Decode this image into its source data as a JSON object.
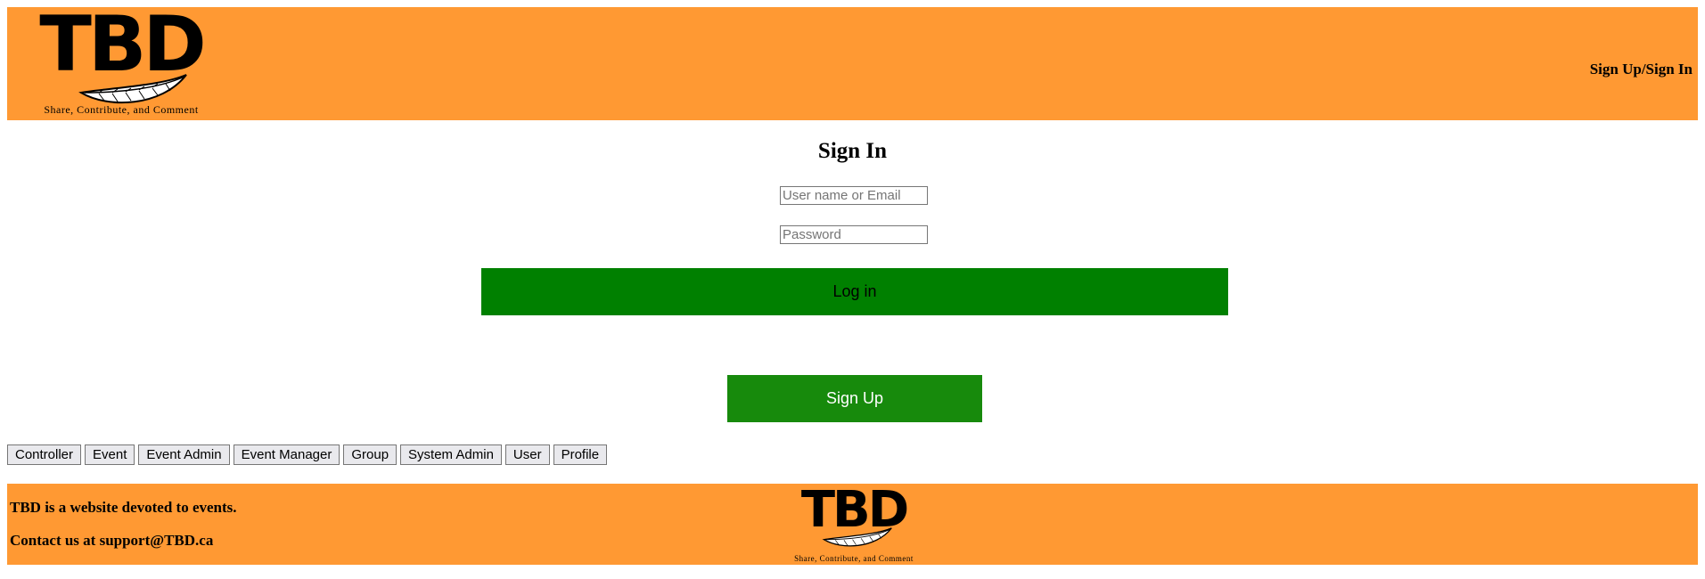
{
  "header": {
    "logo_text": "TBD",
    "tagline": "Share, Contribute, and Comment",
    "nav_link": "Sign Up/Sign In"
  },
  "signin": {
    "title": "Sign In",
    "username_placeholder": "User name or Email",
    "password_placeholder": "Password",
    "login_label": "Log in",
    "signup_label": "Sign Up"
  },
  "tabs": [
    "Controller",
    "Event",
    "Event Admin",
    "Event Manager",
    "Group",
    "System Admin",
    "User",
    "Profile"
  ],
  "footer": {
    "about": "TBD is a website devoted to events.",
    "contact": "Contact us at support@TBD.ca",
    "logo_text": "TBD",
    "tagline": "Share, Contribute, and Comment"
  },
  "colors": {
    "banner": "#ff9933",
    "login_button": "#008000",
    "signup_button": "#178a0c"
  },
  "icons": {
    "logo_emblem": "feather-icon"
  }
}
